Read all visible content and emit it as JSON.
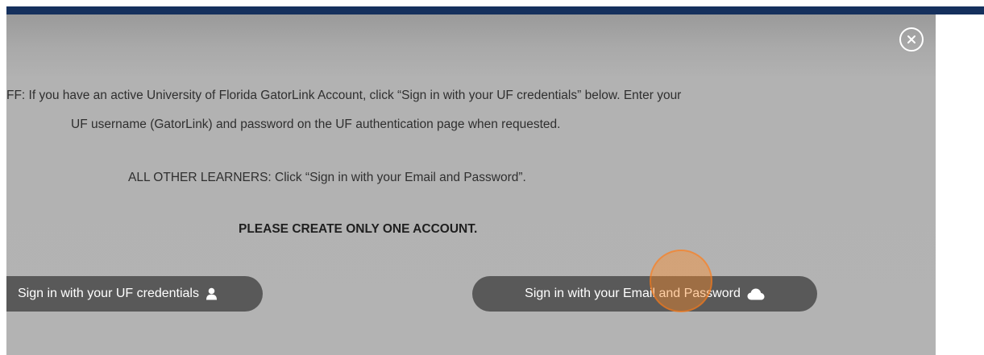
{
  "modal": {
    "close_icon": "close-circle-icon",
    "instructions": {
      "uf_line_1": "FF: If you have an active University of Florida GatorLink Account, click “Sign in with your UF credentials” below. Enter your",
      "uf_line_2": "UF username (GatorLink) and password on the UF authentication page when requested.",
      "other_learners": "ALL OTHER LEARNERS: Click “Sign in with your Email and Password”.",
      "warning": "PLEASE CREATE ONLY ONE ACCOUNT."
    },
    "buttons": {
      "uf_label": "Sign in with your UF credentials",
      "uf_icon": "user-icon",
      "email_label": "Sign in with your Email and Password",
      "email_icon": "cloud-icon"
    }
  },
  "colors": {
    "header_navy": "#15305d",
    "overlay_gray": "#b3b3b3",
    "button_gray": "#595959",
    "cursor_highlight": "#ff8c28"
  }
}
